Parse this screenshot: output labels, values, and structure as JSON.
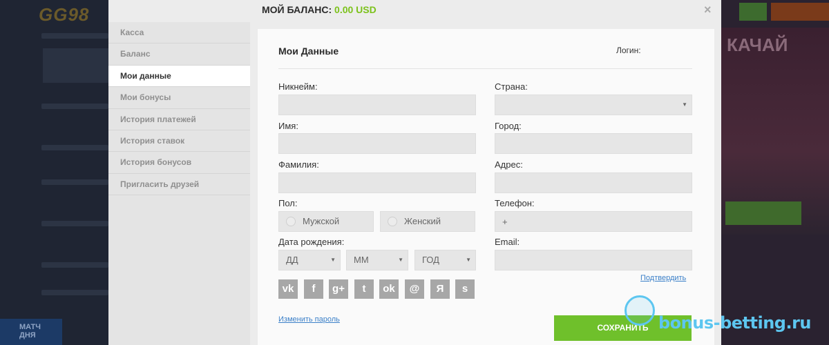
{
  "background": {
    "logo": "GG98",
    "match_label_1": "МАТЧ",
    "match_label_2": "ДНЯ",
    "promo_text": "КАЧАЙ"
  },
  "header": {
    "balance_label": "МОЙ БАЛАНС:",
    "balance_amount": "0.00 USD",
    "close_glyph": "×"
  },
  "sidebar": {
    "items": [
      {
        "label": "Касса"
      },
      {
        "label": "Баланс"
      },
      {
        "label": "Мои данные",
        "active": true
      },
      {
        "label": "Мои бонусы"
      },
      {
        "label": "История платежей"
      },
      {
        "label": "История ставок"
      },
      {
        "label": "История бонусов"
      },
      {
        "label": "Пригласить друзей"
      }
    ]
  },
  "form": {
    "title": "Мои Данные",
    "login_label": "Логин:",
    "nickname_label": "Никнейм:",
    "first_name_label": "Имя:",
    "last_name_label": "Фамилия:",
    "gender_label": "Пол:",
    "gender_male": "Мужской",
    "gender_female": "Женский",
    "birthdate_label": "Дата рождения:",
    "day_placeholder": "ДД",
    "month_placeholder": "ММ",
    "year_placeholder": "ГОД",
    "country_label": "Страна:",
    "city_label": "Город:",
    "address_label": "Адрес:",
    "phone_label": "Телефон:",
    "phone_value": "+",
    "email_label": "Email:",
    "confirm_link": "Подтвердить",
    "change_password_link": "Изменить пароль",
    "save_button": "СОХРАНИТЬ"
  },
  "social": {
    "icons": [
      {
        "name": "vk-icon",
        "glyph": "vk"
      },
      {
        "name": "facebook-icon",
        "glyph": "f"
      },
      {
        "name": "google-plus-icon",
        "glyph": "g+"
      },
      {
        "name": "twitter-icon",
        "glyph": "t"
      },
      {
        "name": "odnoklassniki-icon",
        "glyph": "ok"
      },
      {
        "name": "mailru-icon",
        "glyph": "@"
      },
      {
        "name": "yandex-icon",
        "glyph": "Я"
      },
      {
        "name": "steam-icon",
        "glyph": "s"
      }
    ]
  },
  "watermark": {
    "text": "bonus-betting.ru"
  },
  "colors": {
    "accent_green": "#6fc02b",
    "balance_green": "#7cc21b",
    "link_blue": "#3a7fc8"
  }
}
